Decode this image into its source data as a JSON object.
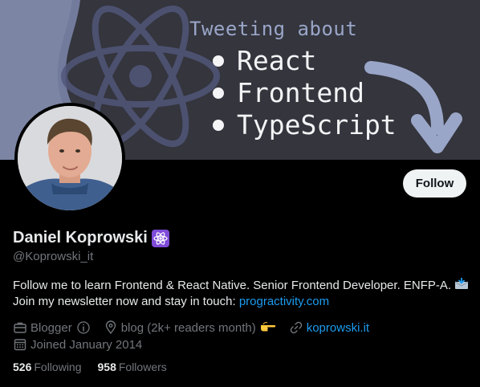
{
  "banner": {
    "heading": "Tweeting about",
    "items": [
      "React",
      "Frontend",
      "TypeScript"
    ]
  },
  "profile": {
    "display_name": "Daniel Koprowski",
    "handle": "@Koprowski_it",
    "badge_icon": "atom-icon",
    "follow_label": "Follow"
  },
  "bio": {
    "line1": "Follow me to learn Frontend & React Native. Senior Frontend Developer. ENFP-A.",
    "line2_text": "Join my newsletter now and stay in touch:",
    "line2_link": "progractivity.com"
  },
  "meta": {
    "category": "Blogger",
    "location": "blog (2k+ readers month)",
    "website": "koprowski.it",
    "joined": "Joined January 2014"
  },
  "stats": {
    "following_count": "526",
    "following_label": "Following",
    "followers_count": "958",
    "followers_label": "Followers"
  },
  "colors": {
    "background": "#000000",
    "banner": "#34353d",
    "accent_link": "#1d9bf0",
    "secondary_text": "#71767b",
    "badge": "#7f4bd8"
  }
}
